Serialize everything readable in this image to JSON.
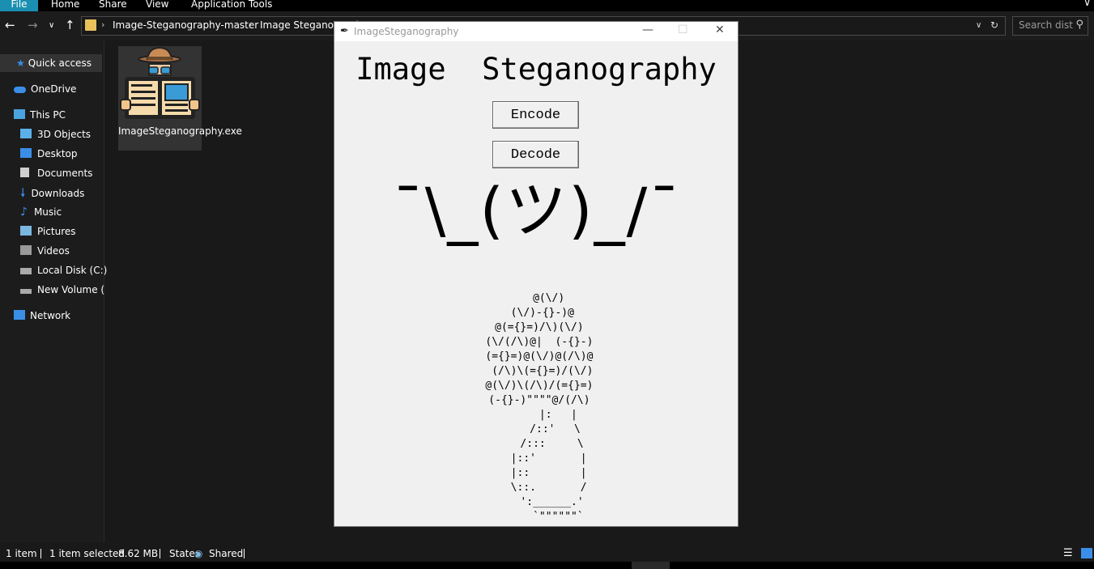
{
  "ribbon": {
    "tabs": [
      "File",
      "Home",
      "Share",
      "View",
      "Application Tools"
    ]
  },
  "address": {
    "crumbs": [
      "Image-Steganography-master",
      "Image Steganography"
    ],
    "search_placeholder": "Search dist"
  },
  "nav": {
    "quick_access": "Quick access",
    "onedrive": "OneDrive",
    "this_pc": "This PC",
    "items": [
      "3D Objects",
      "Desktop",
      "Documents",
      "Downloads",
      "Music",
      "Pictures",
      "Videos",
      "Local Disk (C:)",
      "New Volume (H:)"
    ],
    "network": "Network"
  },
  "file": {
    "name": "ImageSteganography.exe"
  },
  "status": {
    "count": "1 item",
    "selected": "1 item selected",
    "size": "8.62 MB",
    "state_label": "State:",
    "state_value": "Shared"
  },
  "tk": {
    "title": "ImageSteganography",
    "heading": "Image  Steganography",
    "encode": "Encode",
    "decode": "Decode",
    "shrug": "¯\\_(ツ)_/¯",
    "art": "    @(\\/)\n  (\\/)-{}-)@\n @(={}=)/\\)(\\/)\n (\\/(/\\)@|  (-{}-)\n (={}=)@(\\/)@(/\\)@\n  (/\\)\\(={}=)/(\\/)\n @(\\/)\\(/\\)/(={}=)\n (-{}-)\"\"\"\"@/(/\\)\n       |:   |\n      /::'   \\\n     /:::     \\\n    |::'       |\n    |::        |\n    \\::.       /\n     ':______.'\n       `\"\"\"\"\"\"`"
  },
  "colors": {
    "file_tab": "#1a8fb1",
    "pane": "#191919",
    "tk_bg": "#f0f0f0"
  }
}
